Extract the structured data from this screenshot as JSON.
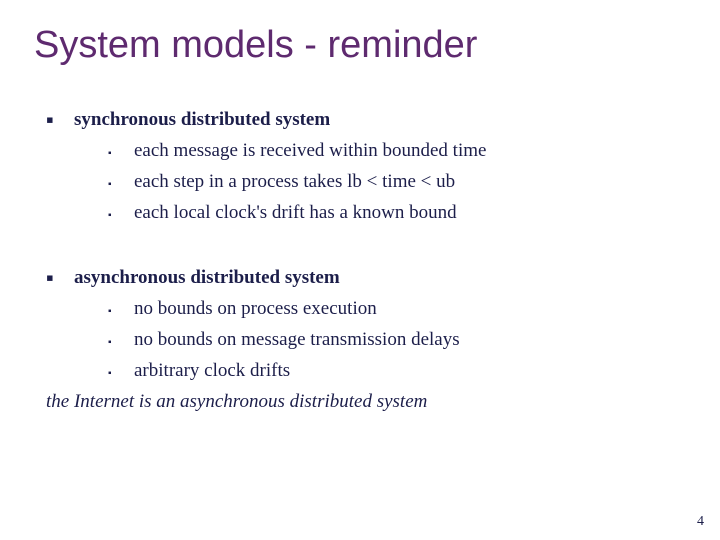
{
  "title": "System models - reminder",
  "sections": [
    {
      "heading": "synchronous distributed system",
      "items": [
        "each message is received within bounded time",
        "each step in a process takes lb < time < ub",
        "each local clock's drift has a known bound"
      ]
    },
    {
      "heading": "asynchronous distributed system",
      "items": [
        "no bounds on process execution",
        "no bounds on message transmission delays",
        "arbitrary clock drifts"
      ]
    }
  ],
  "note": "the Internet is an asynchronous distributed system",
  "page_number": "4"
}
